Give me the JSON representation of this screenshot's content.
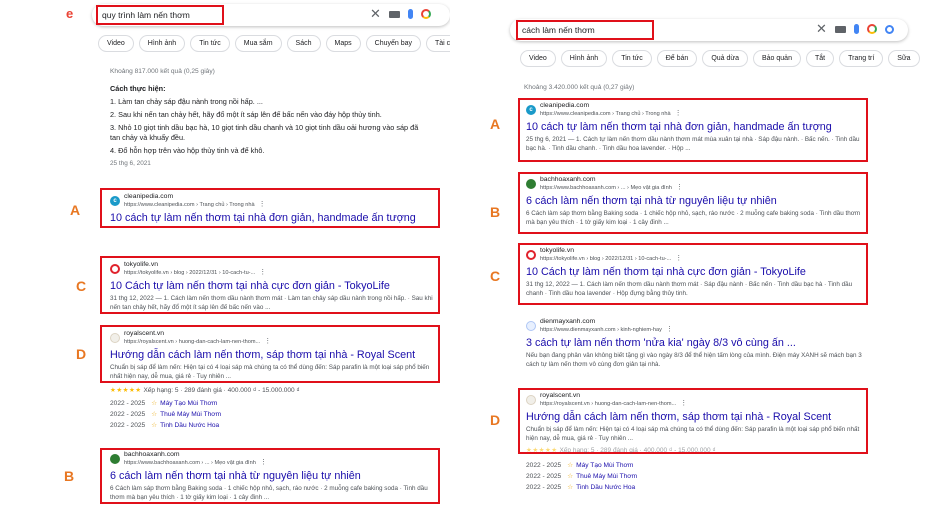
{
  "left": {
    "logo": "e",
    "query": "quy trình làm nến thơm",
    "chips": [
      "Video",
      "Hình ảnh",
      "Tin tức",
      "Mua sắm",
      "Sách",
      "Maps",
      "Chuyến bay",
      "Tài c"
    ],
    "stats": "Khoảng 817.000 kết quả (0,25 giây)",
    "snippet": {
      "heading": "Cách thực hiện:",
      "steps": [
        "1. Làm tan chảy sáp đậu nành trong nồi hấp. ...",
        "2. Sau khi nến tan chảy hết, hãy đổ một ít sáp lên đế bấc nến vào đáy hộp thủy tinh.",
        "3. Nhỏ 10 giọt tinh dầu bạc hà, 10 giọt tinh dầu chanh và 10 giọt tinh dầu oải hương vào sáp đã tan chảy và khuấy đều.",
        "4. Đổ hỗn hợp trên vào hộp thủy tinh và để khô."
      ],
      "date": "25 thg 6, 2021"
    },
    "results": [
      {
        "letter": "A",
        "site": "cleanipedia.com",
        "url": "https://www.cleanipedia.com › Trang chủ › Trong nhà",
        "title": "10 cách tự làm nến thơm tại nhà đơn giản, handmade ấn tượng",
        "desc": ""
      },
      {
        "letter": "C",
        "site": "tokyolife.vn",
        "url": "https://tokyolife.vn › blog › 2022/12/31 › 10-cach-tu-...",
        "title": "10 Cách tự làm nến thơm tại nhà cực đơn giản - TokyoLife",
        "desc": "31 thg 12, 2022 — 1. Cách làm nến thơm dầu nành thơm mát · Làm tan chảy sáp dầu nành trong nồi hấp. · Sau khi nến tan chảy hết, hãy đổ một ít sáp lên đế bấc nến vào ..."
      },
      {
        "letter": "D",
        "site": "royalscent.vn",
        "url": "https://royalscent.vn › huong-dan-cach-lam-nen-thom...",
        "title": "Hướng dẫn cách làm nến thơm, sáp thơm tại nhà - Royal Scent",
        "desc": "Chuẩn bị sáp để làm nến: Hiện tại có 4 loại sáp mà chúng ta có thể dùng đến: Sáp parafin là một loại sáp phổ biến nhất hiện nay, dễ mua, giá rẻ · Tuy nhiên ..."
      },
      {
        "letter": "B",
        "site": "bachhoaxanh.com",
        "url": "https://www.bachhoaxanh.com › ... › Mẹo vặt gia đình",
        "title": "6 cách làm nến thơm tại nhà từ nguyên liệu tự nhiên",
        "desc": "6 Cách làm sáp thơm bằng Baking soda · 1 chiếc hộp nhỏ, sạch, ráo nước · 2 muỗng cafe baking soda · Tinh dầu thơm mà bạn yêu thích · 1 tờ giấy kim loại · 1 cây đinh ..."
      }
    ],
    "rating": {
      "stars": "★★★★★",
      "text": "Xếp hạng: 5 · 289 đánh giá · 400.000 ₫ - 15.000.000 ₫"
    },
    "sublinks": [
      {
        "years": "2022 - 2025",
        "label": "Máy Tạo Mùi Thơm"
      },
      {
        "years": "2022 - 2025",
        "label": "Thuê Máy Mùi Thơm"
      },
      {
        "years": "2022 - 2025",
        "label": "Tinh Dầu Nước Hoa"
      }
    ]
  },
  "right": {
    "query": "cách làm nến thơm",
    "chips": [
      "Video",
      "Hình ảnh",
      "Tin tức",
      "Để bán",
      "Quả dừa",
      "Bảo quản",
      "Tắt",
      "Trang trí",
      "Sữa"
    ],
    "stats": "Khoảng 3.420.000 kết quả (0,27 giây)",
    "results": [
      {
        "letter": "A",
        "site": "cleanipedia.com",
        "url": "https://www.cleanipedia.com › Trang chủ › Trong nhà",
        "title": "10 cách tự làm nến thơm tại nhà đơn giản, handmade ấn tượng",
        "desc": "25 thg 6, 2021 — 1. Cách tự làm nến thơm dầu nành thơm mát mùa xuân tại nhà · Sáp đậu nành. · Bấc nến. · Tinh dầu bạc hà. · Tinh dầu chanh. · Tinh dầu hoa lavender. · Hộp ..."
      },
      {
        "letter": "B",
        "site": "bachhoaxanh.com",
        "url": "https://www.bachhoaxanh.com › ... › Mẹo vặt gia đình",
        "title": "6 cách làm nến thơm tại nhà từ nguyên liệu tự nhiên",
        "desc": "6 Cách làm sáp thơm bằng Baking soda · 1 chiếc hộp nhỏ, sạch, ráo nước · 2 muỗng cafe baking soda · Tinh dầu thơm mà bạn yêu thích · 1 tờ giấy kim loại · 1 cây đinh ..."
      },
      {
        "letter": "C",
        "site": "tokyolife.vn",
        "url": "https://tokyolife.vn › blog › 2022/12/31 › 10-cach-tu-...",
        "title": "10 Cách tự làm nến thơm tại nhà cực đơn giản - TokyoLife",
        "desc": "31 thg 12, 2022 — 1. Cách làm nến thơm dầu nành thơm mát · Sáp đậu nành · Bấc nến · Tinh dầu bạc hà · Tinh dầu chanh · Tinh dầu hoa lavender · Hộp đựng bằng thủy tinh."
      },
      {
        "letter": "",
        "site": "dienmayxanh.com",
        "url": "https://www.dienmayxanh.com › kinh-nghiem-hay",
        "title": "3 cách tự làm nến thơm 'nửa kia' ngày 8/3 vô cùng ấn ...",
        "desc": "Nếu bạn đang phân vân không biết tặng gì vào ngày 8/3 để thể hiện tấm lòng của mình. Điện máy XANH sẽ mách bạn 3 cách tự làm nến thơm vô cùng đơn giản tại nhà."
      },
      {
        "letter": "D",
        "site": "royalscent.vn",
        "url": "https://royalscent.vn › huong-dan-cach-lam-nen-thom...",
        "title": "Hướng dẫn cách làm nến thơm, sáp thơm tại nhà - Royal Scent",
        "desc": "Chuẩn bị sáp để làm nến: Hiện tại có 4 loại sáp mà chúng ta có thể dùng đến: Sáp parafin là một loại sáp phổ biến nhất hiện nay, dễ mua, giá rẻ · Tuy nhiên ..."
      }
    ],
    "rating": {
      "stars": "★★★★★",
      "text": "Xếp hạng: 5 · 289 đánh giá · 400.000 ₫ - 15.000.000 ₫"
    },
    "sublinks": [
      {
        "years": "2022 - 2025",
        "label": "Máy Tạo Mùi Thơm"
      },
      {
        "years": "2022 - 2025",
        "label": "Thuê Máy Mùi Thơm"
      },
      {
        "years": "2022 - 2025",
        "label": "Tinh Dầu Nước Hoa"
      }
    ]
  }
}
